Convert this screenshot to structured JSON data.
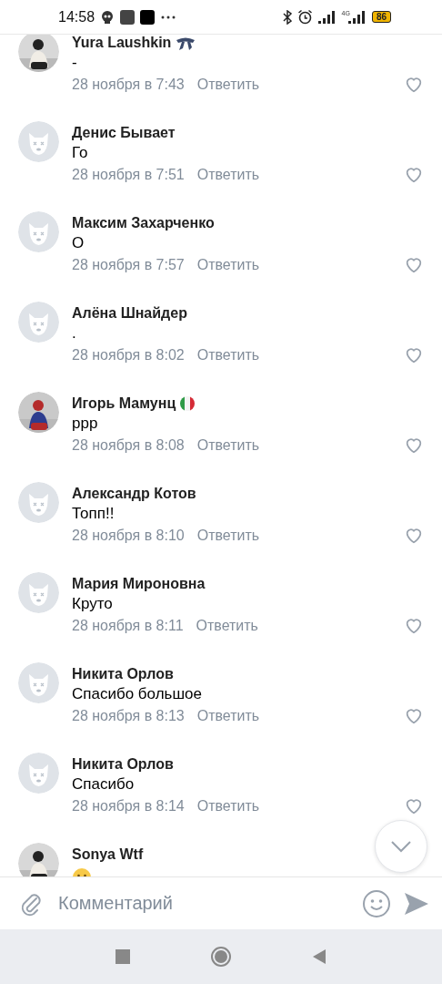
{
  "status_bar": {
    "time": "14:58",
    "network": "4G",
    "battery": "86"
  },
  "comments": [
    {
      "author": "Yura Laushkin",
      "badge": {
        "kind": "ribbon"
      },
      "text": "-",
      "date": "28 ноября в 7:43",
      "reply": "Ответить",
      "liked": false
    },
    {
      "author": "Денис Бывает",
      "avatar": {
        "kind": "default"
      },
      "text": "Го",
      "date": "28 ноября в 7:51",
      "reply": "Ответить",
      "liked": false
    },
    {
      "author": "Максим Захарченко",
      "avatar": {
        "kind": "default"
      },
      "text": "О",
      "date": "28 ноября в 7:57",
      "reply": "Ответить",
      "liked": false
    },
    {
      "author": "Алёна Шнайдер",
      "avatar": {
        "kind": "default"
      },
      "text": ".",
      "date": "28 ноября в 8:02",
      "reply": "Ответить",
      "liked": false
    },
    {
      "author": "Игорь Мамунц",
      "badge": {
        "kind": "flag"
      },
      "text": "ррр",
      "date": "28 ноября в 8:08",
      "reply": "Ответить",
      "liked": false
    },
    {
      "author": "Александр Котов",
      "avatar": {
        "kind": "default"
      },
      "text": "Топп!!",
      "date": "28 ноября в 8:10",
      "reply": "Ответить",
      "liked": false
    },
    {
      "author": "Мария Мироновна",
      "avatar": {
        "kind": "default"
      },
      "text": "Круто",
      "date": "28 ноября в 8:11",
      "reply": "Ответить",
      "liked": false
    },
    {
      "author": "Никита Орлов",
      "avatar": {
        "kind": "default"
      },
      "text": "Спасибо большое",
      "date": "28 ноября в 8:13",
      "reply": "Ответить",
      "liked": false
    },
    {
      "author": "Никита Орлов",
      "avatar": {
        "kind": "default"
      },
      "text": "Спасибо",
      "date": "28 ноября в 8:14",
      "reply": "Ответить",
      "liked": false
    },
    {
      "author": "Sonya Wtf",
      "sticker": {
        "kind": "emoji"
      }
    }
  ],
  "composer": {
    "placeholder": "Комментарий"
  }
}
